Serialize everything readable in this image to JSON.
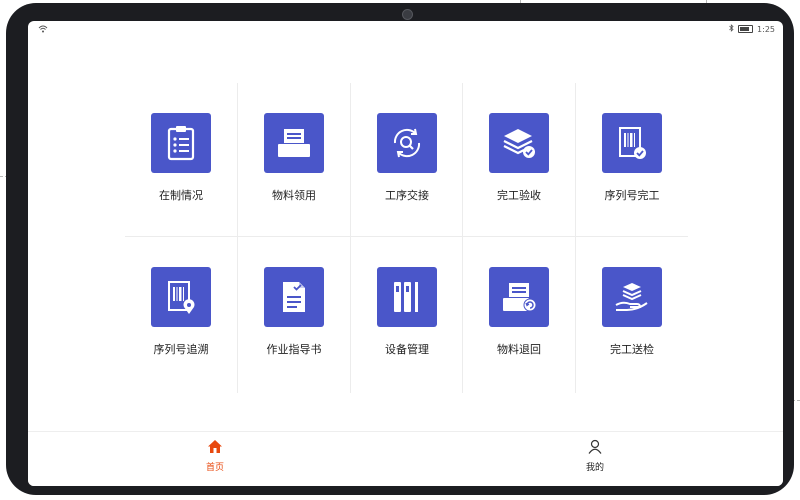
{
  "status_bar": {
    "time": "1:25"
  },
  "menu": [
    {
      "label": "在制情况",
      "icon": "clipboard-list-icon"
    },
    {
      "label": "物料领用",
      "icon": "material-tray-icon"
    },
    {
      "label": "工序交接",
      "icon": "search-cycle-icon"
    },
    {
      "label": "完工验收",
      "icon": "layers-check-icon"
    },
    {
      "label": "序列号完工",
      "icon": "barcode-check-icon"
    },
    {
      "label": "序列号追溯",
      "icon": "barcode-location-icon"
    },
    {
      "label": "作业指导书",
      "icon": "document-check-icon"
    },
    {
      "label": "设备管理",
      "icon": "equipment-bars-icon"
    },
    {
      "label": "物料退回",
      "icon": "material-return-icon"
    },
    {
      "label": "完工送检",
      "icon": "hand-layers-icon"
    }
  ],
  "tabbar": {
    "home": {
      "label": "首页",
      "color": "#e8490f"
    },
    "mine": {
      "label": "我的",
      "color": "#222222"
    }
  },
  "colors": {
    "tile_bg": "#4a56c9",
    "device_frame": "#1c1d21"
  }
}
